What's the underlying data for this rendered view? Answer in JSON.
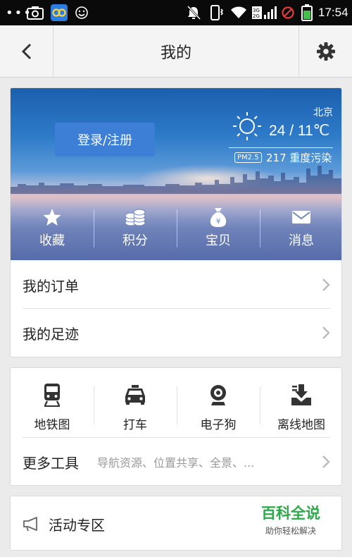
{
  "status_bar": {
    "dots": "•••",
    "time": "17:54",
    "icons": [
      "camera-icon",
      "app-icon",
      "smile-icon",
      "mute-icon",
      "vibrate-icon",
      "wifi-icon",
      "signal-icon",
      "blocked-icon",
      "battery-icon"
    ]
  },
  "navbar": {
    "title": "我的",
    "back_icon": "chevron-left-icon",
    "settings_icon": "gear-icon"
  },
  "profile": {
    "login_label": "登录/注册",
    "weather": {
      "city": "北京",
      "temp": "24 / 11℃",
      "pm_badge": "PM2.5",
      "aqi": "217 重度污染",
      "icon": "sun-icon"
    },
    "quick_actions": [
      {
        "label": "收藏",
        "icon": "star-icon"
      },
      {
        "label": "积分",
        "icon": "coins-icon"
      },
      {
        "label": "宝贝",
        "icon": "money-bag-icon"
      },
      {
        "label": "消息",
        "icon": "envelope-icon"
      }
    ],
    "rows": [
      {
        "label": "我的订单"
      },
      {
        "label": "我的足迹"
      }
    ]
  },
  "tools": {
    "items": [
      {
        "label": "地铁图",
        "icon": "subway-icon"
      },
      {
        "label": "打车",
        "icon": "taxi-icon"
      },
      {
        "label": "电子狗",
        "icon": "camera-dog-icon"
      },
      {
        "label": "离线地图",
        "icon": "download-map-icon"
      }
    ],
    "more_label": "更多工具",
    "more_desc": "导航资源、位置共享、全景、..."
  },
  "activity": {
    "label": "活动专区",
    "icon": "megaphone-icon"
  },
  "watermark": {
    "title": "百科全说",
    "subtitle": "助你轻松解决"
  },
  "colors": {
    "accent": "#3d7fd6",
    "watermark_green": "#2ea84a",
    "background": "#ebebeb"
  }
}
